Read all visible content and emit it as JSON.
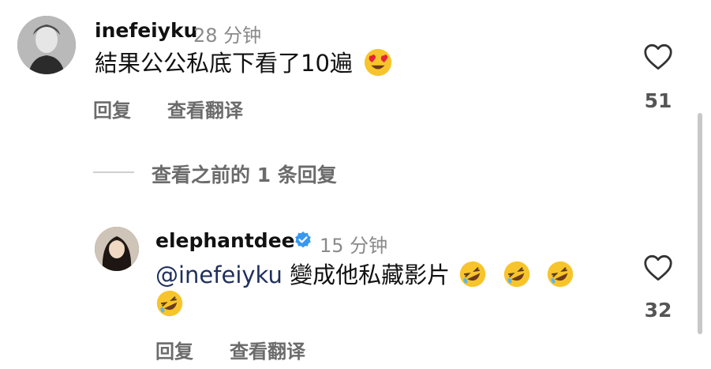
{
  "comments": [
    {
      "username": "inefeiyku",
      "time": "28 分钟",
      "text": "結果公公私底下看了10遍",
      "emoji": "smiling-face-with-heart-eyes",
      "actions": {
        "reply": "回复",
        "translate": "查看翻译"
      },
      "likes": "51"
    }
  ],
  "view_previous": "查看之前的 1 条回复",
  "reply": {
    "username": "elephantdee",
    "verified": true,
    "time": "15 分钟",
    "mention": "@inefeiyku",
    "text": "變成他私藏影片",
    "emoji": "rolling-on-the-floor-laughing",
    "actions": {
      "reply": "回复",
      "translate": "查看翻译"
    },
    "likes": "32"
  },
  "colors": {
    "verified_badge": "#3897f0",
    "emoji_face": "#f7c52b",
    "heart_eyes": "#e6223a"
  }
}
